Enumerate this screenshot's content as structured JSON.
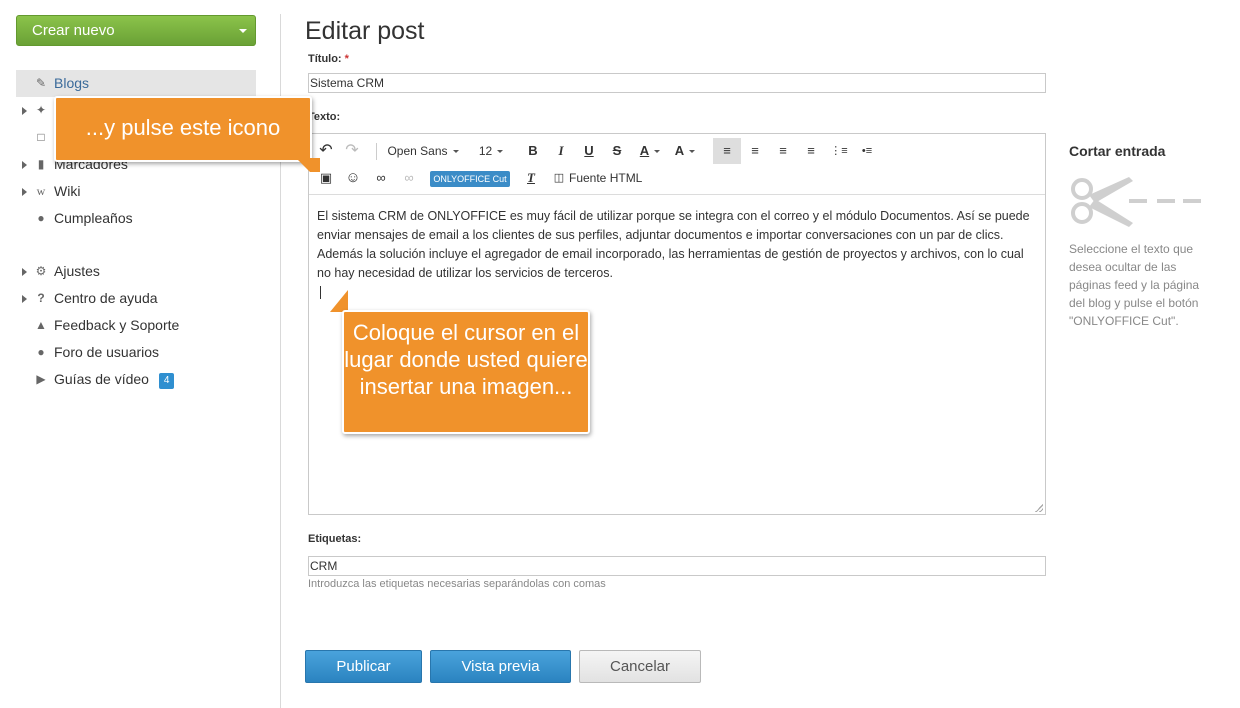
{
  "sidebar": {
    "create_label": "Crear nuevo",
    "items": [
      {
        "label": "Blogs",
        "icon": "edit-icon"
      },
      {
        "label": "",
        "icon": "pin-icon"
      },
      {
        "label": "",
        "icon": "comment-icon"
      },
      {
        "label": "Marcadores",
        "icon": "bookmark-icon"
      },
      {
        "label": "Wiki",
        "icon": "wiki-icon"
      },
      {
        "label": "Cumpleaños",
        "icon": "people-icon"
      }
    ],
    "bottom_items": [
      {
        "label": "Ajustes",
        "icon": "gear-icon"
      },
      {
        "label": "Centro de ayuda",
        "icon": "question-icon"
      },
      {
        "label": "Feedback y Soporte",
        "icon": "megaphone-icon"
      },
      {
        "label": "Foro de usuarios",
        "icon": "chat-icon"
      },
      {
        "label": "Guías de vídeo",
        "icon": "video-icon",
        "badge": "4"
      }
    ]
  },
  "main": {
    "page_title": "Editar post",
    "title_label": "Título:",
    "required_mark": "*",
    "title_value": "Sistema CRM",
    "text_label": "Texto:",
    "toolbar": {
      "font_family": "Open Sans",
      "font_size": "12",
      "bold": "B",
      "italic": "I",
      "underline": "U",
      "strike": "S",
      "font_color": "A",
      "bg_color": "A",
      "cut_label": "ONLYOFFICE Cut",
      "clear_format": "T",
      "source_label": "Fuente HTML"
    },
    "body_text": "El sistema CRM de ONLYOFFICE es muy fácil de utilizar porque se integra con el correo y el módulo Documentos. Así se puede enviar mensajes de email a los clientes de sus perfiles, adjuntar documentos e importar conversaciones con un par de clics. Además la solución incluye el agregador de email incorporado, las herramientas de gestión de proyectos y archivos, con lo cual no hay necesidad de utilizar los servicios de terceros.",
    "tags_label": "Etiquetas:",
    "tags_value": "CRM",
    "tags_hint": "Introduzca las etiquetas necesarias separándolas con comas",
    "buttons": {
      "publish": "Publicar",
      "preview": "Vista previa",
      "cancel": "Cancelar"
    }
  },
  "right_panel": {
    "title": "Cortar entrada",
    "description": "Seleccione el texto que desea ocultar de las páginas feed y la página del blog y pulse el botón \"ONLYOFFICE Cut\"."
  },
  "callouts": {
    "icon_hint": "...y pulse este icono",
    "cursor_hint": "Coloque el cursor en el lugar donde usted quiere insertar una imagen..."
  },
  "colors": {
    "create_green": "#6aa136",
    "primary_blue": "#2b83c0",
    "callout_orange": "#f0922b"
  }
}
